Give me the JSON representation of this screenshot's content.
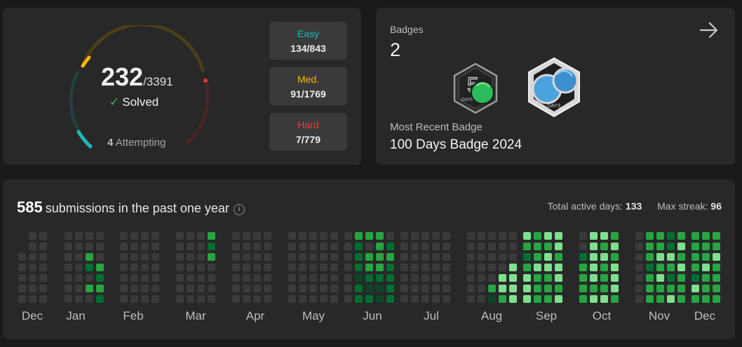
{
  "progress": {
    "solved": "232",
    "total": "/3391",
    "solved_label": "Solved",
    "attempting_count": "4",
    "attempting_label": "Attempting",
    "difficulties": [
      {
        "name": "Easy",
        "value": "134/843",
        "color": "#1cbaba"
      },
      {
        "name": "Med.",
        "value": "91/1769",
        "color": "#ffb700"
      },
      {
        "name": "Hard",
        "value": "7/779",
        "color": "#f63737"
      }
    ]
  },
  "badges": {
    "title": "Badges",
    "count": "2",
    "items": [
      {
        "icon": "50-days-badge-icon",
        "label": "DAYS"
      },
      {
        "icon": "100-days-badge-icon",
        "label": "DAYS"
      }
    ],
    "recent_title": "Most Recent Badge",
    "recent_name": "100 Days Badge 2024"
  },
  "submissions": {
    "count": "585",
    "label": "submissions in the past one year",
    "active_days_label": "Total active days:",
    "active_days": "133",
    "max_streak_label": "Max streak:",
    "max_streak": "96",
    "months": [
      "Dec",
      "Jan",
      "Feb",
      "Mar",
      "Apr",
      "May",
      "Jun",
      "Jul",
      "Aug",
      "Sep",
      "Oct",
      "Nov",
      "Dec"
    ],
    "colors": {
      "empty": "#3a3a3a",
      "l1": "#0e4429",
      "l2": "#006d32",
      "l3": "#26a641",
      "l4": "#7ee08f"
    }
  }
}
